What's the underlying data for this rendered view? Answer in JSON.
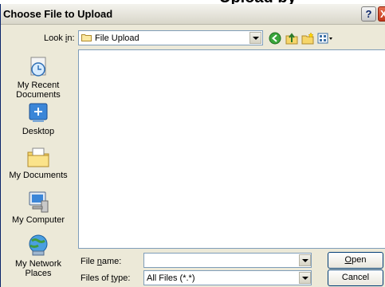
{
  "page": {
    "header_fragment": "Upload by"
  },
  "window": {
    "title": "Choose File to Upload",
    "help_glyph": "?",
    "close_glyph": "X"
  },
  "toolbar": {
    "look_in_label_pre": "Look ",
    "look_in_label_access": "i",
    "look_in_label_post": "n:",
    "look_in_value": "File Upload",
    "icons": [
      "back-icon",
      "up-folder-icon",
      "new-folder-icon",
      "views-menu-icon"
    ]
  },
  "places": [
    {
      "label": "My Recent Documents",
      "icon": "recent-documents-icon"
    },
    {
      "label": "Desktop",
      "icon": "desktop-icon"
    },
    {
      "label": "My Documents",
      "icon": "my-documents-icon"
    },
    {
      "label": "My Computer",
      "icon": "my-computer-icon"
    },
    {
      "label": "My Network Places",
      "icon": "network-places-icon"
    }
  ],
  "form": {
    "file_name_label_pre": "File ",
    "file_name_label_access": "n",
    "file_name_label_post": "ame:",
    "file_name_value": "",
    "file_type_label_pre": "Files of ",
    "file_type_label_access": "t",
    "file_type_label_post": "ype:",
    "file_type_value": "All Files (*.*)",
    "open_pre": "",
    "open_access": "O",
    "open_post": "pen",
    "cancel_label": "Cancel"
  }
}
